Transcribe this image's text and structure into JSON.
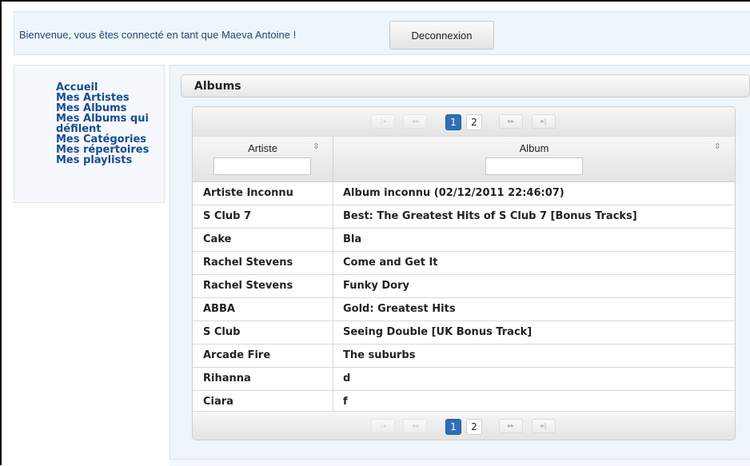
{
  "header": {
    "welcome_text": "Bienvenue, vous êtes connecté en tant que Maeva Antoine !",
    "logout_label": "Deconnexion"
  },
  "sidebar": {
    "items": [
      {
        "label": "Accueil"
      },
      {
        "label": "Mes Artistes"
      },
      {
        "label": "Mes Albums"
      },
      {
        "label": "Mes Albums qui défilent"
      },
      {
        "label": "Mes Catégories"
      },
      {
        "label": "Mes répertoires"
      },
      {
        "label": "Mes playlists"
      }
    ]
  },
  "panel": {
    "title": "Albums"
  },
  "pager": {
    "first_icon": "first-page-icon",
    "prev_icon": "prev-page-icon",
    "next_icon": "next-page-icon",
    "last_icon": "last-page-icon",
    "pages": [
      "1",
      "2"
    ],
    "current_page": "1"
  },
  "table": {
    "columns": [
      {
        "label": "Artiste",
        "filter_value": "",
        "sort_icon": "sort-icon"
      },
      {
        "label": "Album",
        "filter_value": "",
        "sort_icon": "sort-icon"
      }
    ],
    "rows": [
      {
        "artist": "Artiste Inconnu",
        "album": "Album inconnu (02/12/2011 22:46:07)"
      },
      {
        "artist": "S Club 7",
        "album": "Best: The Greatest Hits of S Club 7 [Bonus Tracks]"
      },
      {
        "artist": "Cake",
        "album": "Bla"
      },
      {
        "artist": "Rachel Stevens",
        "album": "Come and Get It"
      },
      {
        "artist": "Rachel Stevens",
        "album": "Funky Dory"
      },
      {
        "artist": "ABBA",
        "album": "Gold: Greatest Hits"
      },
      {
        "artist": "S Club",
        "album": "Seeing Double [UK Bonus Track]"
      },
      {
        "artist": "Arcade Fire",
        "album": "The suburbs"
      },
      {
        "artist": "Rihanna",
        "album": "d"
      },
      {
        "artist": "Ciara",
        "album": "f"
      }
    ]
  }
}
